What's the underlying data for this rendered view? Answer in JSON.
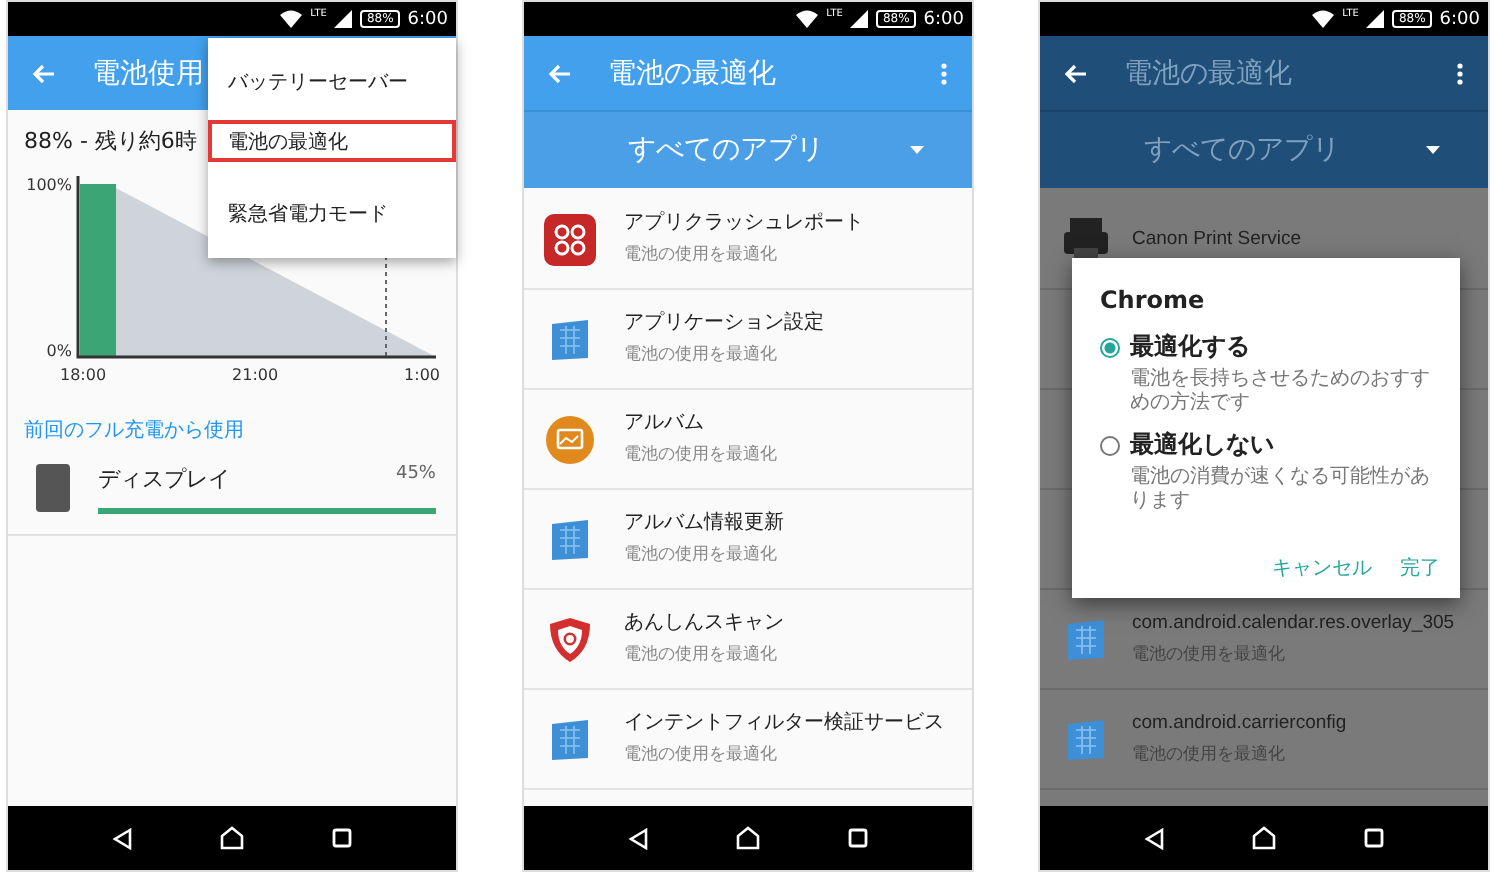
{
  "phones": [
    {
      "kind": "usage",
      "status_bar": {
        "network": "LTE",
        "battery": "88%",
        "time": "6:00"
      },
      "app_bar": {
        "title": "電池使用",
        "overflow": false
      },
      "summary": "88% - 残り約6時",
      "chart": {
        "y_labels": [
          "100%",
          "0%"
        ],
        "x_labels": [
          "18:00",
          "21:00",
          "1:00"
        ]
      },
      "section_header": "前回のフル充電から使用",
      "usage_items": [
        {
          "name": "ディスプレイ",
          "percent": "45%",
          "level": 1
        }
      ],
      "menu": [
        {
          "label": "バッテリーセーバー",
          "selected": false
        },
        {
          "label": "電池の最適化",
          "selected": true
        },
        {
          "label": "緊急省電力モード",
          "selected": false
        }
      ]
    },
    {
      "kind": "list",
      "status_bar": {
        "network": "LTE",
        "battery": "88%",
        "time": "6:00"
      },
      "app_bar": {
        "title": "電池の最適化",
        "overflow": true
      },
      "filter": "すべてのアプリ",
      "apps": [
        {
          "kind": "crash",
          "title": "アプリクラッシュレポート",
          "subtitle": "電池の使用を最適化"
        },
        {
          "kind": "tile",
          "title": "アプリケーション設定",
          "subtitle": "電池の使用を最適化"
        },
        {
          "kind": "album",
          "title": "アルバム",
          "subtitle": "電池の使用を最適化"
        },
        {
          "kind": "tile",
          "title": "アルバム情報更新",
          "subtitle": "電池の使用を最適化"
        },
        {
          "kind": "shield",
          "title": "あんしんスキャン",
          "subtitle": "電池の使用を最適化"
        },
        {
          "kind": "tile",
          "title": "インテントフィルター検証サービス",
          "subtitle": "電池の使用を最適化"
        }
      ]
    },
    {
      "kind": "dialog",
      "status_bar": {
        "network": "LTE",
        "battery": "88%",
        "time": "6:00"
      },
      "app_bar": {
        "title": "電池の最適化",
        "overflow": true
      },
      "filter": "すべてのアプリ",
      "apps_above": [
        {
          "kind": "printer",
          "title": "Canon Print Service"
        }
      ],
      "apps_below": [
        {
          "kind": "tile",
          "title": "com.android.calendar.res.overlay_305",
          "subtitle": "電池の使用を最適化"
        },
        {
          "kind": "tile",
          "title": "com.android.carrierconfig",
          "subtitle": "電池の使用を最適化"
        }
      ],
      "dialog": {
        "title": "Chrome",
        "options": [
          {
            "label": "最適化する",
            "description": "電池を長持ちさせるためのおすすめの方法です",
            "selected": true
          },
          {
            "label": "最適化しない",
            "description": "電池の消費が速くなる可能性があります",
            "selected": false
          }
        ],
        "buttons": [
          "キャンセル",
          "完了"
        ]
      }
    }
  ]
}
